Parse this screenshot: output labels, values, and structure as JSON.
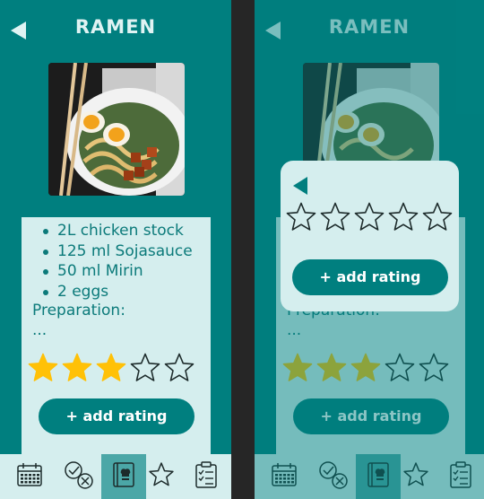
{
  "recipe": {
    "title": "RAMEN",
    "ingredients": [
      "2L chicken stock",
      "125 ml Sojasauce",
      "50 ml Mirin",
      "2 eggs"
    ],
    "preparation_label": "Preparation:",
    "preparation_text": "..."
  },
  "rating": {
    "value": 3,
    "max": 5,
    "filled_color": "#ffc107"
  },
  "add_rating_label": "+ add rating",
  "nav": {
    "items": [
      "calendar-icon",
      "done-undone-icon",
      "recipe-book-icon",
      "favorites-star-icon",
      "checklist-icon"
    ],
    "active_index": 2
  },
  "colors": {
    "primary": "#007f7f",
    "panel": "#d5eeee",
    "title": "#dff3f3",
    "divider": "#262626"
  }
}
